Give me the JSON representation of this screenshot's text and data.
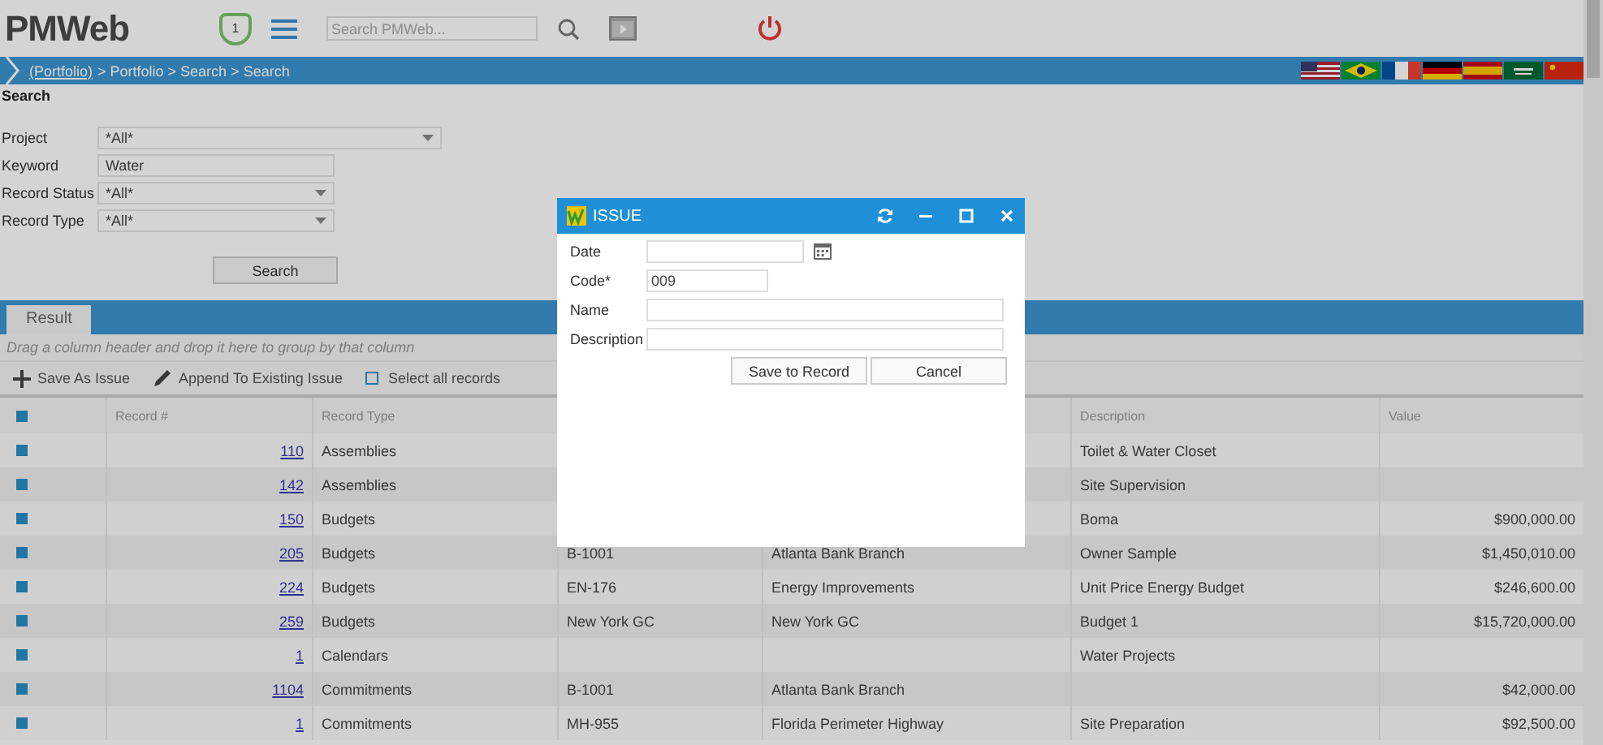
{
  "header": {
    "logo": "PMWeb",
    "badge": "1",
    "search_placeholder": "Search PMWeb..."
  },
  "breadcrumb": {
    "link": "(Portfolio)",
    "path": "> Portfolio > Search > Search"
  },
  "search_form": {
    "title": "Search",
    "button": "Search",
    "fields": [
      {
        "label": "Project",
        "value": "*All*",
        "kind": "dropdown"
      },
      {
        "label": "Keyword",
        "value": "Water",
        "kind": "text"
      },
      {
        "label": "Record Status",
        "value": "*All*",
        "kind": "dropdown"
      },
      {
        "label": "Record Type",
        "value": "*All*",
        "kind": "dropdown"
      }
    ]
  },
  "results": {
    "tab": "Result",
    "group_hint": "Drag a column header and drop it here to group by that column",
    "toolbar": [
      {
        "label": "Save As Issue",
        "kind": "add"
      },
      {
        "label": "Append To Existing Issue",
        "kind": "edit"
      }
    ],
    "select_all": {
      "label": "Select all records",
      "checked": false
    },
    "columns": {
      "record": "Record #",
      "type": "Record Type",
      "description": "Description",
      "value": "Value"
    },
    "rows": [
      {
        "record": "110",
        "type": "Assemblies",
        "description": "Toilet & Water Closet"
      },
      {
        "record": "142",
        "type": "Assemblies",
        "description": "Site Supervision"
      },
      {
        "record": "150",
        "type": "Budgets",
        "description": "Boma",
        "value": "$900,000.00"
      },
      {
        "record": "205",
        "type": "Budgets",
        "column_4": "B-1001",
        "column_5": "Atlanta Bank Branch",
        "description": "Owner Sample",
        "value": "$1,450,010.00"
      },
      {
        "record": "224",
        "type": "Budgets",
        "column_4": "EN-176",
        "column_5": "Energy Improvements",
        "description": "Unit Price Energy Budget",
        "value": "$246,600.00"
      },
      {
        "record": "259",
        "type": "Budgets",
        "column_4": "New York GC",
        "column_5": "New York GC",
        "description": "Budget 1",
        "value": "$15,720,000.00"
      },
      {
        "record": "1",
        "type": "Calendars",
        "description": "Water Projects"
      },
      {
        "record": "1104",
        "type": "Commitments",
        "column_4": "B-1001",
        "column_5": "Atlanta Bank Branch",
        "value": "$42,000.00"
      },
      {
        "record": "1",
        "type": "Commitments",
        "column_4": "MH-955",
        "column_5": "Florida Perimeter Highway",
        "description": "Site Preparation",
        "value": "$92,500.00"
      }
    ]
  },
  "dialog": {
    "title": "ISSUE",
    "fields": [
      {
        "label": "Date",
        "kind": "date"
      },
      {
        "label": "Code*",
        "kind": "short",
        "value": "009"
      },
      {
        "label": "Name",
        "kind": "wide"
      },
      {
        "label": "Description",
        "kind": "wide"
      }
    ],
    "buttons": [
      "Save to Record",
      "Cancel"
    ]
  }
}
